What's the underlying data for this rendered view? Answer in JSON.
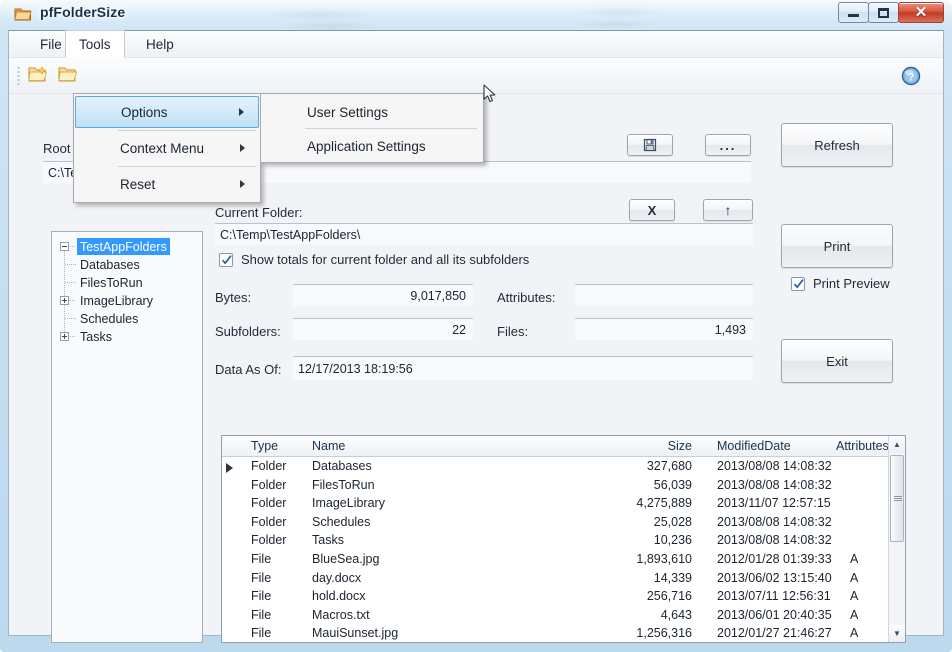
{
  "window": {
    "title": "pfFolderSize",
    "icon": "folder-icon",
    "minimize_label": "Minimize",
    "maximize_label": "Maximize",
    "close_label": "Close",
    "close_glyph": "✕"
  },
  "menubar": {
    "items": [
      {
        "label": "File",
        "name": "menu-file"
      },
      {
        "label": "Tools",
        "name": "menu-tools"
      },
      {
        "label": "Help",
        "name": "menu-help"
      }
    ]
  },
  "tools_menu": {
    "items": [
      {
        "label": "Options",
        "has_submenu": true,
        "highlighted": true
      },
      {
        "label": "Context Menu",
        "has_submenu": true,
        "highlighted": false
      },
      {
        "label": "Reset",
        "has_submenu": true,
        "highlighted": false
      }
    ]
  },
  "options_submenu": {
    "items": [
      {
        "label": "User Settings"
      },
      {
        "label": "Application Settings"
      }
    ]
  },
  "toolbar": {
    "icons": [
      {
        "name": "new-folder-icon"
      },
      {
        "name": "open-folder-icon"
      }
    ],
    "help_icon": "help-icon",
    "help_glyph": "?"
  },
  "root_folder": {
    "label": "Root Folder:",
    "value": "C:\\Temp\\TestAppFolders\\",
    "save_button": {
      "name": "save-root-folder-button",
      "icon": "save-disk-icon"
    },
    "browse_button": {
      "name": "browse-folder-button",
      "label": "..."
    }
  },
  "refresh_button": {
    "label": "Refresh"
  },
  "print_button": {
    "label": "Print"
  },
  "print_preview": {
    "label": "Print Preview",
    "checked": true
  },
  "exit_button": {
    "label": "Exit"
  },
  "tree": {
    "items": [
      {
        "label": "TestAppFolders",
        "level": 0,
        "selected": true,
        "expander": "minus"
      },
      {
        "label": "Databases",
        "level": 1,
        "selected": false,
        "expander": "none"
      },
      {
        "label": "FilesToRun",
        "level": 1,
        "selected": false,
        "expander": "none"
      },
      {
        "label": "ImageLibrary",
        "level": 1,
        "selected": false,
        "expander": "plus"
      },
      {
        "label": "Schedules",
        "level": 1,
        "selected": false,
        "expander": "none"
      },
      {
        "label": "Tasks",
        "level": 1,
        "selected": false,
        "expander": "plus"
      }
    ]
  },
  "current_folder": {
    "label": "Current Folder:",
    "value": "C:\\Temp\\TestAppFolders\\",
    "clear_button": {
      "name": "clear-button",
      "label": "X"
    },
    "up_button": {
      "name": "up-folder-button",
      "label": "↑"
    }
  },
  "show_totals": {
    "label": "Show totals for current folder and all its subfolders",
    "checked": true
  },
  "stats": {
    "bytes_label": "Bytes:",
    "bytes_value": "9,017,850",
    "attributes_label": "Attributes:",
    "attributes_value": "",
    "subfolders_label": "Subfolders:",
    "subfolders_value": "22",
    "files_label": "Files:",
    "files_value": "1,493",
    "data_as_of_label": "Data As Of:",
    "data_as_of_value": "12/17/2013 18:19:56"
  },
  "grid": {
    "columns": [
      "Type",
      "Name",
      "Size",
      "ModifiedDate",
      "Attributes"
    ],
    "rows": [
      {
        "type": "Folder",
        "name": "Databases",
        "size": "327,680",
        "modified": "2013/08/08 14:08:32",
        "attributes": "",
        "selected": true
      },
      {
        "type": "Folder",
        "name": "FilesToRun",
        "size": "56,039",
        "modified": "2013/08/08 14:08:32",
        "attributes": "",
        "selected": false
      },
      {
        "type": "Folder",
        "name": "ImageLibrary",
        "size": "4,275,889",
        "modified": "2013/11/07 12:57:15",
        "attributes": "",
        "selected": false
      },
      {
        "type": "Folder",
        "name": "Schedules",
        "size": "25,028",
        "modified": "2013/08/08 14:08:32",
        "attributes": "",
        "selected": false
      },
      {
        "type": "Folder",
        "name": "Tasks",
        "size": "10,236",
        "modified": "2013/08/08 14:08:32",
        "attributes": "",
        "selected": false
      },
      {
        "type": "File",
        "name": "BlueSea.jpg",
        "size": "1,893,610",
        "modified": "2012/01/28 01:39:33",
        "attributes": "A",
        "selected": false
      },
      {
        "type": "File",
        "name": "day.docx",
        "size": "14,339",
        "modified": "2013/06/02 13:15:40",
        "attributes": "A",
        "selected": false
      },
      {
        "type": "File",
        "name": "hold.docx",
        "size": "256,716",
        "modified": "2013/07/11 12:56:31",
        "attributes": "A",
        "selected": false
      },
      {
        "type": "File",
        "name": "Macros.txt",
        "size": "4,643",
        "modified": "2013/06/01 20:40:35",
        "attributes": "A",
        "selected": false
      },
      {
        "type": "File",
        "name": "MauiSunset.jpg",
        "size": "1,256,316",
        "modified": "2012/01/27 21:46:27",
        "attributes": "A",
        "selected": false
      }
    ],
    "scroll_up_glyph": "▲",
    "scroll_down_glyph": "▼"
  },
  "colors": {
    "accent": "#3399ff",
    "title_text": "#18314f",
    "menu_highlight": "#5ca8e0",
    "close_button": "#bf3b24",
    "client_bg": "#f1f3f7"
  }
}
